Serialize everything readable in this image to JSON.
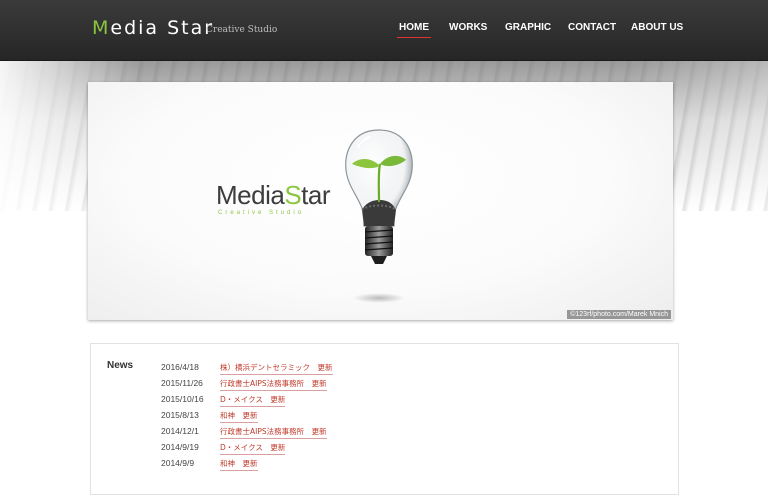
{
  "header": {
    "logo_first": "M",
    "logo_rest": "edia Star",
    "tagline": "Creative Studio",
    "nav": [
      "HOME",
      "WORKS",
      "GRAPHIC",
      "CONTACT",
      "ABOUT US"
    ],
    "active_nav": "HOME"
  },
  "hero": {
    "logo_part1": "Media",
    "logo_s": "S",
    "logo_part2": "tar",
    "subtitle": "Creative Studio",
    "credit": "©123rf/photo.com/Marek Mnich"
  },
  "news": {
    "title": "News",
    "items": [
      {
        "date": "2016/4/18",
        "text": "株）横浜デントセラミック　更新"
      },
      {
        "date": "2015/11/26",
        "text": "行政書士AIPS法務事務所　更新"
      },
      {
        "date": "2015/10/16",
        "text": "D・メイクス　更新"
      },
      {
        "date": "2015/8/13",
        "text": "和神　更新"
      },
      {
        "date": "2014/12/1",
        "text": "行政書士AIPS法務事務所　更新"
      },
      {
        "date": "2014/9/19",
        "text": "D・メイクス　更新"
      },
      {
        "date": "2014/9/9",
        "text": "和神　更新"
      }
    ]
  },
  "colors": {
    "accent_green": "#8cc63f",
    "link_red": "#c0392b",
    "header_bg": "#2e2e2e"
  },
  "icons": [
    "lightbulb-sprout-image"
  ]
}
